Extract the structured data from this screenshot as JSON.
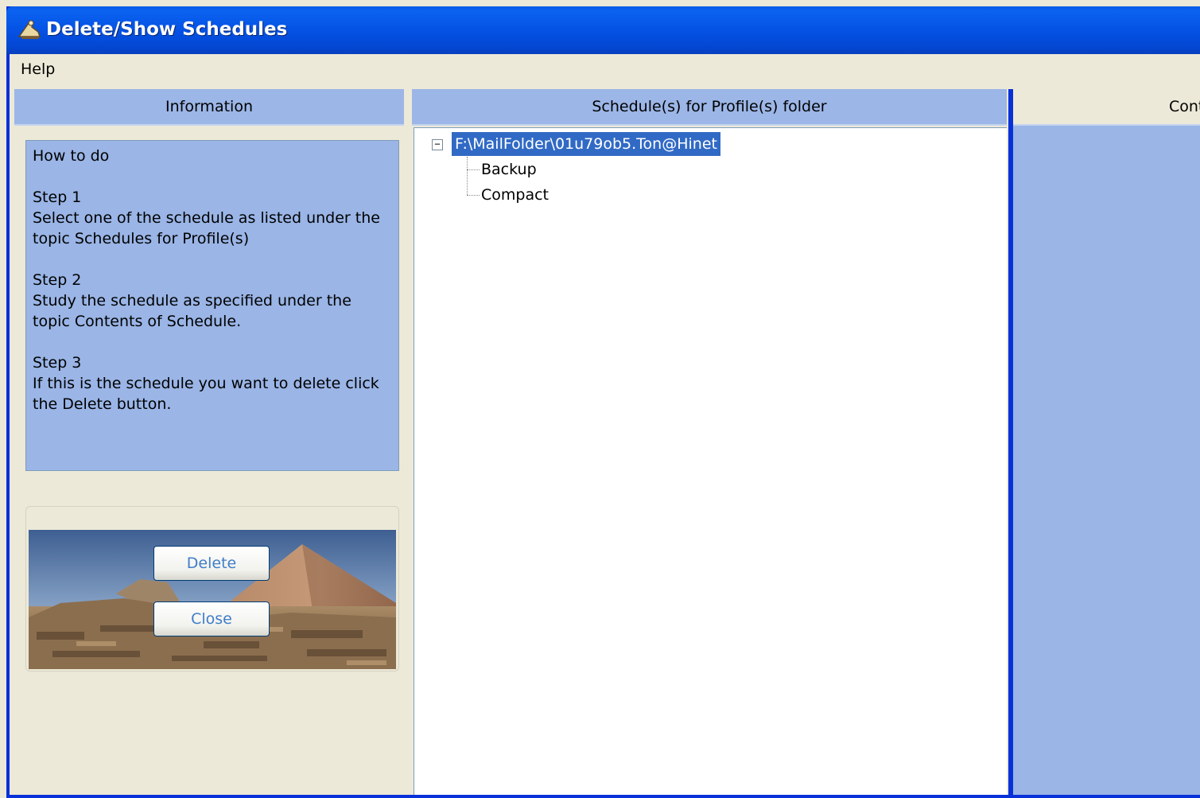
{
  "window": {
    "title": "Delete/Show Schedules",
    "icon": "app-icon"
  },
  "menu": {
    "items": [
      "Help"
    ]
  },
  "info_panel": {
    "header": "Information",
    "howto_title": "How to do",
    "steps": [
      {
        "label": "Step 1",
        "text": "Select one of the schedule as listed under the topic Schedules for Profile(s)"
      },
      {
        "label": "Step 2",
        "text": "Study the schedule as specified under the topic Contents of Schedule."
      },
      {
        "label": "Step 3",
        "text": "If this is the schedule you want to delete click the Delete button."
      }
    ],
    "delete_label": "Delete",
    "close_label": "Close"
  },
  "tree_panel": {
    "header": "Schedule(s) for Profile(s) folder",
    "root": "F:\\MailFolder\\01u79ob5.Ton@Hinet",
    "expander": "−",
    "children": [
      "Backup",
      "Compact"
    ]
  },
  "contents_panel": {
    "header": "Cont"
  },
  "colors": {
    "title_bar": "#0a5ce6",
    "panel_blue": "#9ab5e6",
    "selection": "#316ac5",
    "button_text": "#3f7ec8"
  }
}
